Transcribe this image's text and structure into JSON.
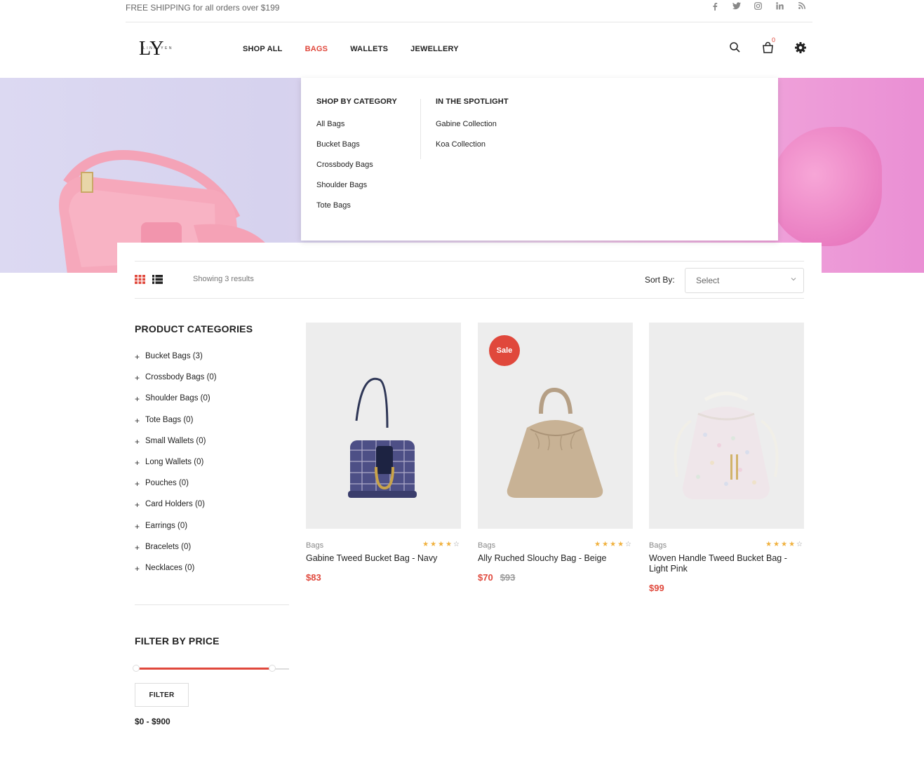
{
  "topbar": {
    "shipping": "FREE SHIPPING for all orders over $199",
    "social": [
      "facebook-icon",
      "twitter-icon",
      "instagram-icon",
      "linkedin-icon",
      "rss-icon"
    ]
  },
  "header": {
    "logo": {
      "mark": "LY",
      "text": "LINH YEN"
    },
    "nav": [
      "SHOP ALL",
      "BAGS",
      "WALLETS",
      "JEWELLERY"
    ],
    "active_nav": "BAGS",
    "cart_count": "0"
  },
  "mega_menu": {
    "col1": {
      "title": "SHOP BY CATEGORY",
      "items": [
        "All Bags",
        "Bucket Bags",
        "Crossbody Bags",
        "Shoulder Bags",
        "Tote Bags"
      ]
    },
    "col2": {
      "title": "IN THE SPOTLIGHT",
      "items": [
        "Gabine Collection",
        "Koa Collection"
      ]
    }
  },
  "toolbar": {
    "showing": "Showing 3 results",
    "sort_label": "Sort By:",
    "sort_value": "Select"
  },
  "sidebar": {
    "categories_title": "PRODUCT CATEGORIES",
    "categories": [
      "Bucket Bags (3)",
      "Crossbody Bags (0)",
      "Shoulder Bags (0)",
      "Tote Bags (0)",
      "Small Wallets (0)",
      "Long Wallets (0)",
      "Pouches (0)",
      "Card Holders (0)",
      "Earrings (0)",
      "Bracelets (0)",
      "Necklaces (0)"
    ],
    "price_title": "FILTER BY PRICE",
    "filter_button": "FILTER",
    "price_range": "$0 - $900",
    "price_slider": {
      "min": 0,
      "max": 900,
      "low": 0,
      "high": 900
    }
  },
  "products": [
    {
      "category": "Bags",
      "name": "Gabine Tweed Bucket Bag - Navy",
      "price": "$83",
      "old_price": "",
      "sale": "",
      "rating": 4
    },
    {
      "category": "Bags",
      "name": "Ally Ruched Slouchy Bag - Beige",
      "price": "$70",
      "old_price": "$93",
      "sale": "Sale",
      "rating": 4
    },
    {
      "category": "Bags",
      "name": "Woven Handle Tweed Bucket Bag - Light Pink",
      "price": "$99",
      "old_price": "",
      "sale": "",
      "rating": 4
    }
  ],
  "colors": {
    "accent": "#e0483c",
    "star": "#f0b03c"
  }
}
